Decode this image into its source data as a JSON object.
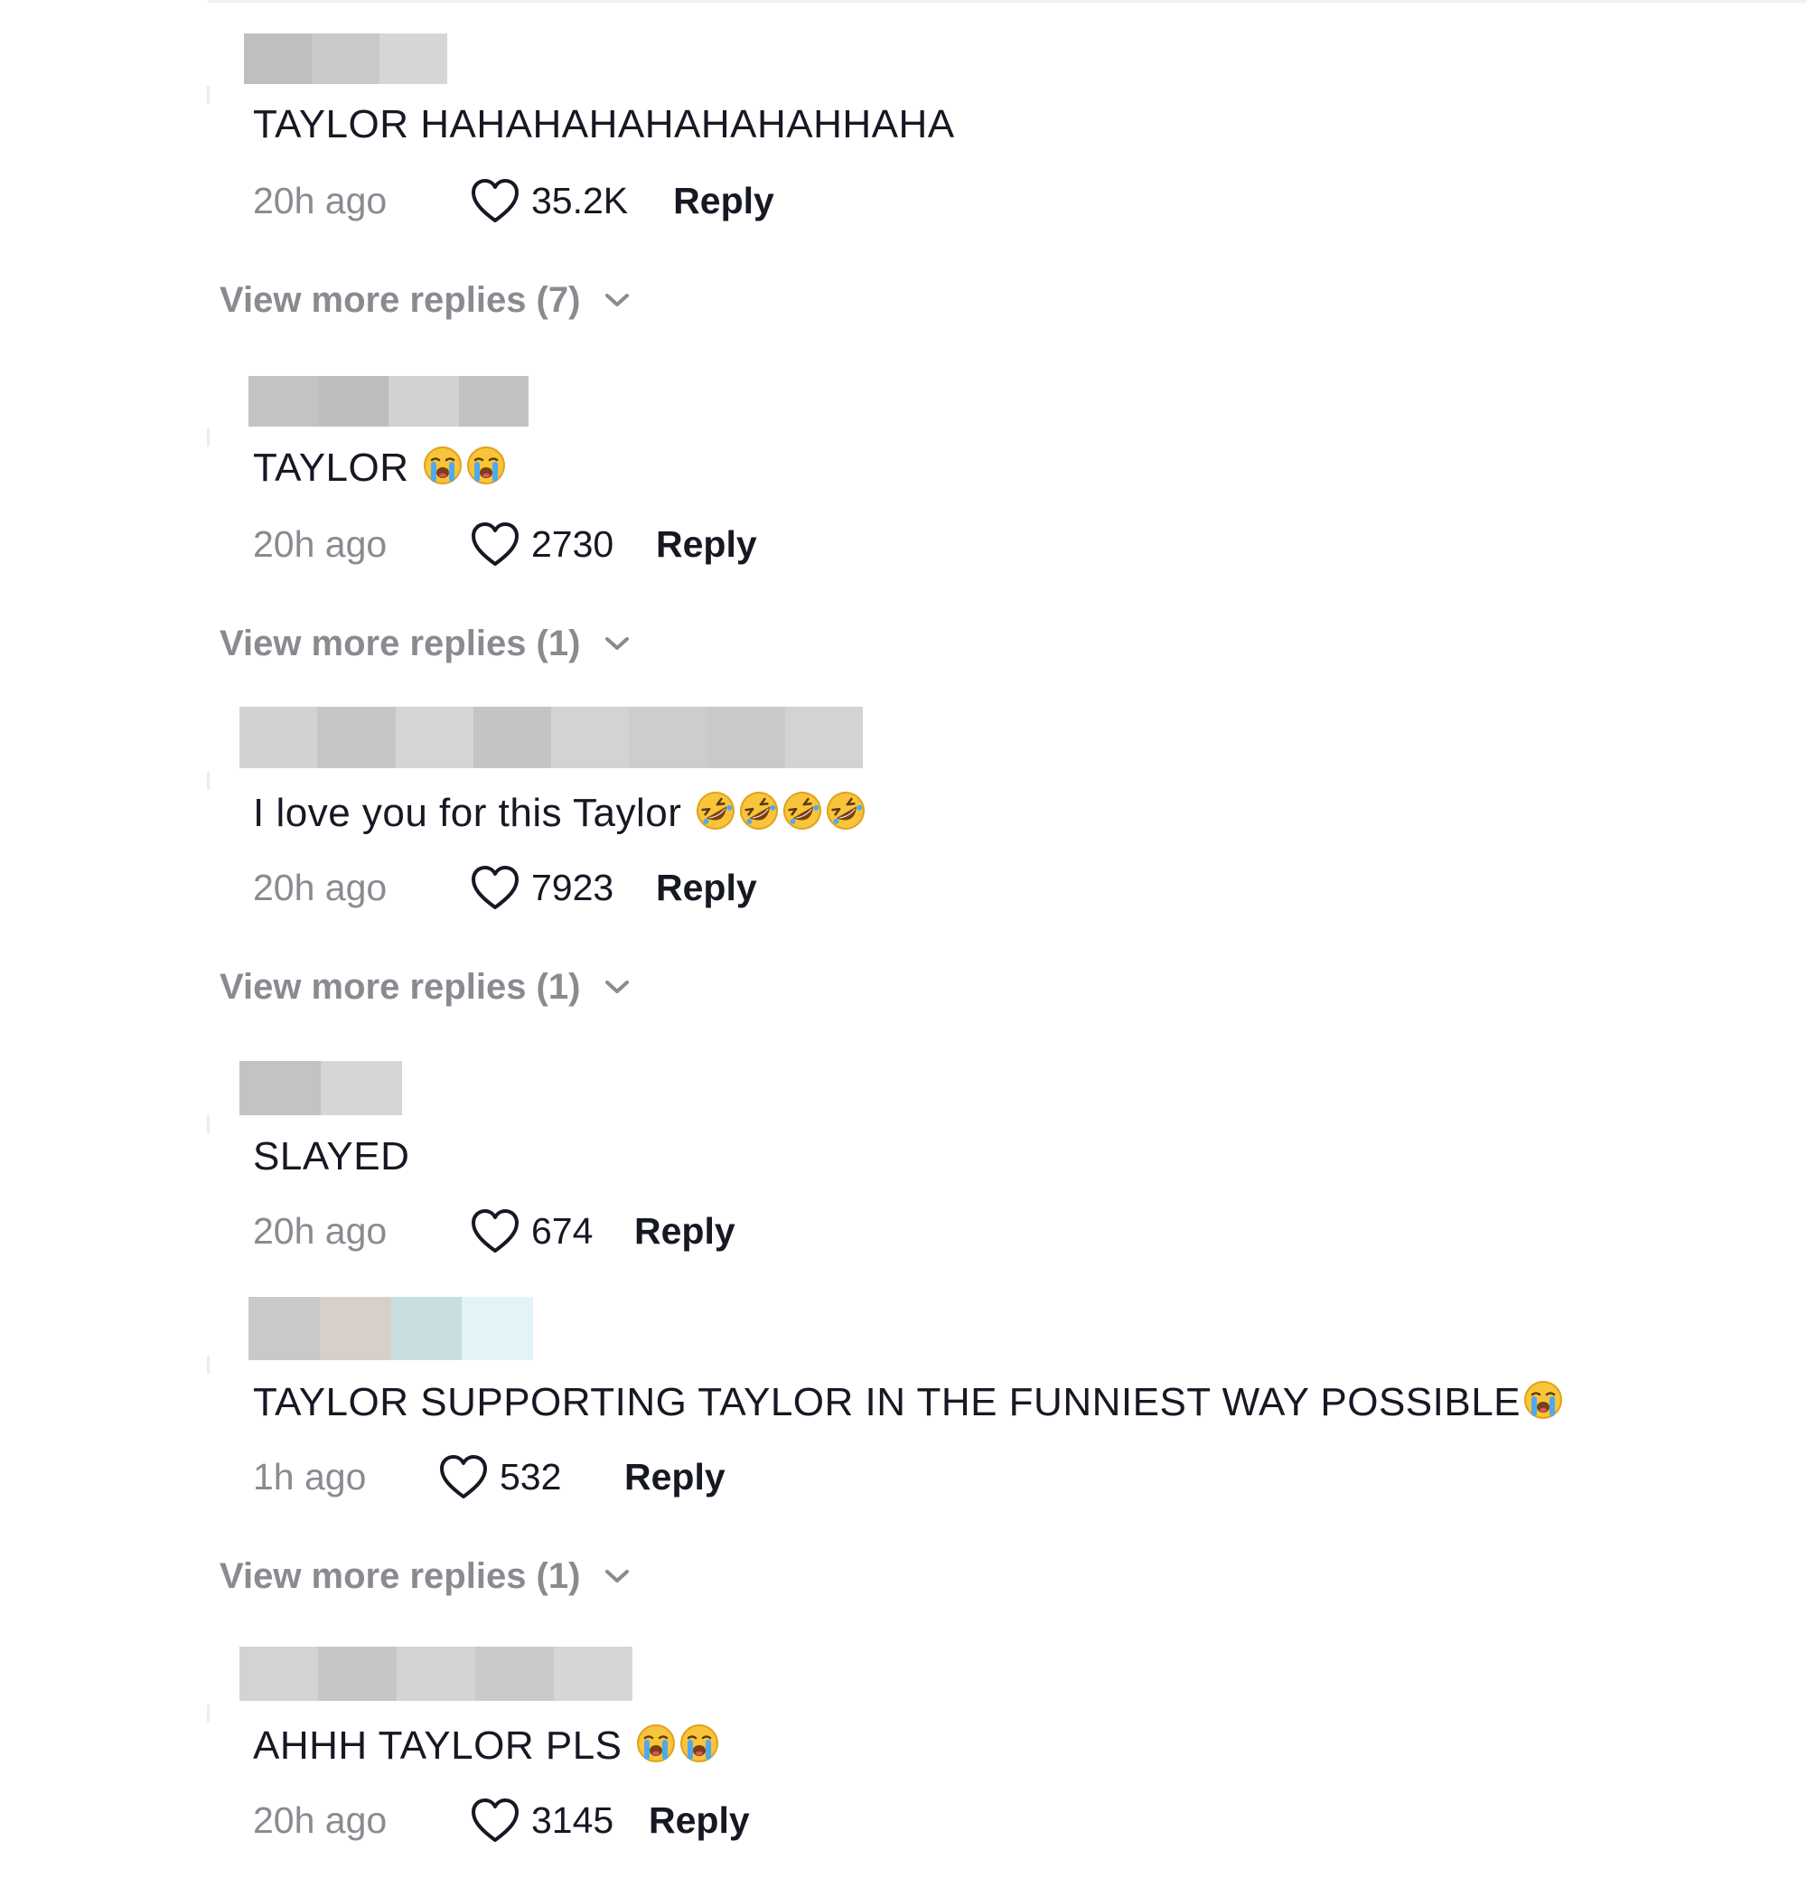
{
  "comments": [
    {
      "text": "TAYLOR HAHAHAHAHAHAHAHHAHA",
      "time": "20h ago",
      "likes": "35.2K",
      "reply_label": "Reply",
      "username_blur": [
        "#bfbfc1",
        "#c9c9cb",
        "#d6d6d8"
      ],
      "view_more": "View more replies (7)"
    },
    {
      "text": "TAYLOR",
      "emoji": [
        "loudly-crying-face-emoji",
        "loudly-crying-face-emoji"
      ],
      "time": "20h ago",
      "likes": "2730",
      "reply_label": "Reply",
      "username_blur": [
        "#c3c3c5",
        "#bdbdbf",
        "#d2d2d4",
        "#c2c2c4"
      ],
      "view_more": "View more replies (1)"
    },
    {
      "text": "I love you for this Taylor",
      "emoji": [
        "rolling-on-floor-laughing-emoji",
        "rolling-on-floor-laughing-emoji",
        "rolling-on-floor-laughing-emoji",
        "rolling-on-floor-laughing-emoji"
      ],
      "time": "20h ago",
      "likes": "7923",
      "reply_label": "Reply",
      "username_blur": [
        "#d2d2d4",
        "#c6c6c8",
        "#d5d5d7",
        "#c4c4c6",
        "#d3d3d5",
        "#cdcdcf",
        "#c9c9cb",
        "#d3d3d5"
      ],
      "view_more": "View more replies (1)"
    },
    {
      "text": "SLAYED",
      "time": "20h ago",
      "likes": "674",
      "reply_label": "Reply",
      "username_blur": [
        "#c3c3c5",
        "#d6d6d8"
      ]
    },
    {
      "text": "TAYLOR SUPPORTING TAYLOR IN THE FUNNIEST WAY POSSIBLE",
      "emoji": [
        "loudly-crying-face-emoji"
      ],
      "time": "1h ago",
      "likes": "532",
      "reply_label": "Reply",
      "username_blur": [
        "#c9c9cb",
        "#d8cfc9",
        "#c8dedf",
        "#e3f4f8"
      ],
      "view_more": "View more replies (1)"
    },
    {
      "text": "AHHH TAYLOR PLS",
      "emoji": [
        "loudly-crying-face-emoji",
        "loudly-crying-face-emoji"
      ],
      "time": "20h ago",
      "likes": "3145",
      "reply_label": "Reply",
      "username_blur": [
        "#d3d3d5",
        "#c6c6c8",
        "#d4d4d6",
        "#cacacc",
        "#d6d6d8"
      ]
    }
  ]
}
